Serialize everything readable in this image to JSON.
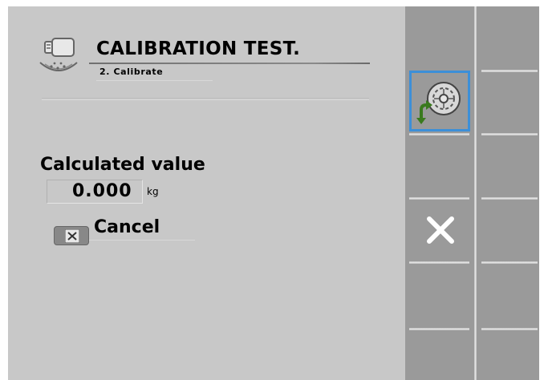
{
  "header": {
    "title": "CALIBRATION TEST.",
    "subtitle": "2. Calibrate"
  },
  "main": {
    "calculated_label": "Calculated value",
    "value": "0.000",
    "unit": "kg",
    "cancel_label": "Cancel"
  },
  "softkeys": [
    {
      "name": "calibrate-wheel",
      "icon": "wheel-calibration-icon",
      "selected": true
    },
    {
      "name": "cancel",
      "icon": "close-icon",
      "selected": false
    }
  ],
  "colors": {
    "screen_bg": "#c8c8c8",
    "softkey_bg": "#9a9a9a",
    "selection": "#3c8fd8",
    "arrow_green": "#3a7a1e"
  }
}
